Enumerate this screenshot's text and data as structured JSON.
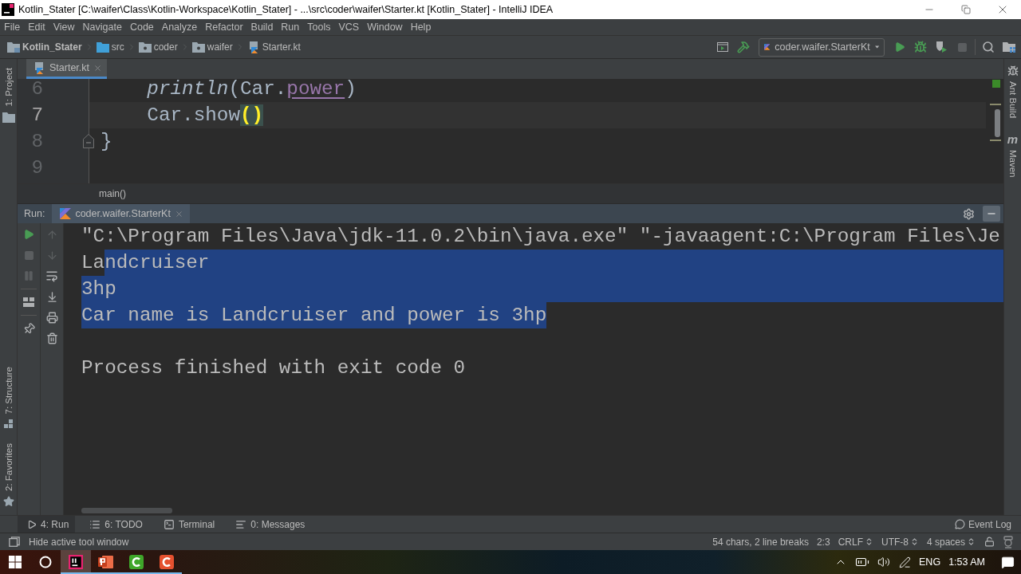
{
  "window": {
    "title": "Kotlin_Stater [C:\\waifer\\Class\\Kotlin-Workspace\\Kotlin_Stater] - ...\\src\\coder\\waifer\\Starter.kt [Kotlin_Stater] - IntelliJ IDEA"
  },
  "menu": [
    "File",
    "Edit",
    "View",
    "Navigate",
    "Code",
    "Analyze",
    "Refactor",
    "Build",
    "Run",
    "Tools",
    "VCS",
    "Window",
    "Help"
  ],
  "navigation": {
    "breadcrumbs": [
      {
        "label": "Kotlin_Stater",
        "kind": "project"
      },
      {
        "label": "src",
        "kind": "source"
      },
      {
        "label": "coder",
        "kind": "package"
      },
      {
        "label": "waifer",
        "kind": "package"
      },
      {
        "label": "Starter.kt",
        "kind": "file"
      }
    ],
    "tools_left": [
      {
        "kind": "run-window",
        "disabled": false
      },
      {
        "kind": "build",
        "disabled": false
      }
    ],
    "run_config": "coder.waifer.StarterKt",
    "tools_right": [
      {
        "kind": "run",
        "disabled": false
      },
      {
        "kind": "debug",
        "disabled": false
      },
      {
        "kind": "coverage",
        "disabled": false
      },
      {
        "kind": "stop",
        "disabled": true
      }
    ],
    "tools_end": [
      {
        "kind": "search",
        "disabled": false
      },
      {
        "kind": "project-structure",
        "disabled": false
      }
    ]
  },
  "left_stripe": {
    "top": [
      {
        "label": "1: Project",
        "kind": "project"
      }
    ],
    "bottom": [
      {
        "label": "7: Structure",
        "kind": "structure"
      },
      {
        "label": "2: Favorites",
        "kind": "favorites"
      }
    ]
  },
  "right_stripe": [
    {
      "label": "Ant Build",
      "kind": "ant"
    },
    {
      "label": "Maven",
      "kind": "maven",
      "glyph": "m"
    }
  ],
  "editor": {
    "tabs": [
      {
        "label": "Starter.kt",
        "selected": true
      }
    ],
    "lines": [
      {
        "number": "6",
        "current": false,
        "fold": false,
        "tokens": [
          {
            "text": "    println",
            "kind": "call"
          },
          {
            "text": "(Car.",
            "kind": "plain"
          },
          {
            "text": "power",
            "kind": "mutable-property"
          },
          {
            "text": ")",
            "kind": "plain"
          }
        ]
      },
      {
        "number": "7",
        "current": true,
        "fold": false,
        "tokens": [
          {
            "text": "    Car.show",
            "kind": "plain"
          },
          {
            "text": "()",
            "kind": "brace-match"
          }
        ]
      },
      {
        "number": "8",
        "current": false,
        "fold": true,
        "tokens": [
          {
            "text": "}",
            "kind": "plain"
          }
        ]
      },
      {
        "number": "9",
        "current": false,
        "fold": false
      }
    ],
    "breadcrumb": "main()"
  },
  "run": {
    "title": "Run:",
    "tabs": [
      {
        "label": "coder.waifer.StarterKt",
        "selected": true
      }
    ],
    "left_groups": [
      {
        "actions": [
          {
            "kind": "rerun",
            "disabled": false
          },
          {
            "kind": "stop",
            "disabled": true
          },
          {
            "kind": "pause",
            "disabled": true
          }
        ]
      },
      {
        "actions": [
          {
            "kind": "layout",
            "disabled": false
          }
        ]
      },
      {
        "actions": [
          {
            "kind": "pin",
            "disabled": false
          }
        ]
      }
    ],
    "right_actions": [
      {
        "kind": "up",
        "disabled": true
      },
      {
        "kind": "down",
        "disabled": true
      },
      {
        "kind": "soft-wrap",
        "disabled": false
      },
      {
        "kind": "scroll-end",
        "disabled": false
      },
      {
        "kind": "print",
        "disabled": false
      },
      {
        "kind": "clear",
        "disabled": false
      }
    ],
    "console": [
      {
        "kind": "command",
        "eol_selected": false,
        "segments": [
          {
            "text": "\"C:\\Program Files\\Java\\jdk-11.0.2\\bin\\java.exe\" \"-javaagent:C:\\Program Files\\Je",
            "selected": false
          }
        ]
      },
      {
        "kind": "output",
        "eol_selected": true,
        "segments": [
          {
            "text": "La",
            "selected": false
          },
          {
            "text": "ndcruiser",
            "selected": true
          }
        ]
      },
      {
        "kind": "output",
        "eol_selected": true,
        "segments": [
          {
            "text": "3hp",
            "selected": true
          }
        ]
      },
      {
        "kind": "output",
        "eol_selected": false,
        "segments": [
          {
            "text": "Car name is Landcruiser and power is 3hp",
            "selected": true
          }
        ]
      },
      {
        "kind": "exit",
        "eol_selected": false,
        "segments": [
          {
            "text": "Process finished with exit code 0",
            "selected": false
          }
        ]
      }
    ]
  },
  "bottom_tools": [
    {
      "label": "4: Run",
      "kind": "run",
      "selected": true
    },
    {
      "label": "6: TODO",
      "kind": "todo",
      "selected": false
    },
    {
      "label": "Terminal",
      "kind": "terminal",
      "selected": false
    },
    {
      "label": "0: Messages",
      "kind": "messages",
      "selected": false
    }
  ],
  "event_log": "Event Log",
  "status_bar": {
    "message": "Hide active tool window",
    "items": [
      {
        "text": "54 chars, 2 line breaks",
        "kind": "info"
      },
      {
        "text": "2:3",
        "kind": "info"
      },
      {
        "text": "CRLF",
        "kind": "select"
      },
      {
        "text": "UTF-8",
        "kind": "select"
      },
      {
        "text": "4 spaces",
        "kind": "select"
      }
    ]
  },
  "taskbar": {
    "apps": [
      {
        "kind": "intellij",
        "active": true,
        "running": true
      },
      {
        "kind": "powerpoint",
        "active": false,
        "running": true
      },
      {
        "kind": "camtasia",
        "active": false,
        "running": true
      },
      {
        "kind": "camtasia-recorder",
        "active": false,
        "running": true
      }
    ],
    "language": "ENG",
    "time": "1:53 AM"
  }
}
